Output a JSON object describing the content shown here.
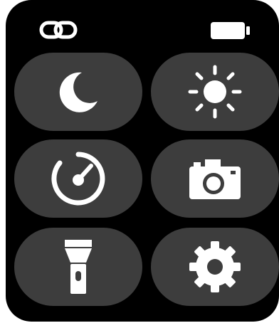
{
  "status_bar": {
    "connection_icon": "link-icon",
    "battery_icon": "battery-icon",
    "battery_level": 1.0
  },
  "controls": [
    {
      "id": "do-not-disturb",
      "icon": "moon-icon"
    },
    {
      "id": "brightness",
      "icon": "sun-icon"
    },
    {
      "id": "stopwatch",
      "icon": "timer-icon"
    },
    {
      "id": "remote-camera",
      "icon": "camera-icon"
    },
    {
      "id": "flashlight",
      "icon": "flashlight-icon"
    },
    {
      "id": "settings",
      "icon": "gear-icon"
    }
  ],
  "colors": {
    "background": "#000000",
    "tile": "#3d3d3d",
    "icon": "#ffffff"
  }
}
